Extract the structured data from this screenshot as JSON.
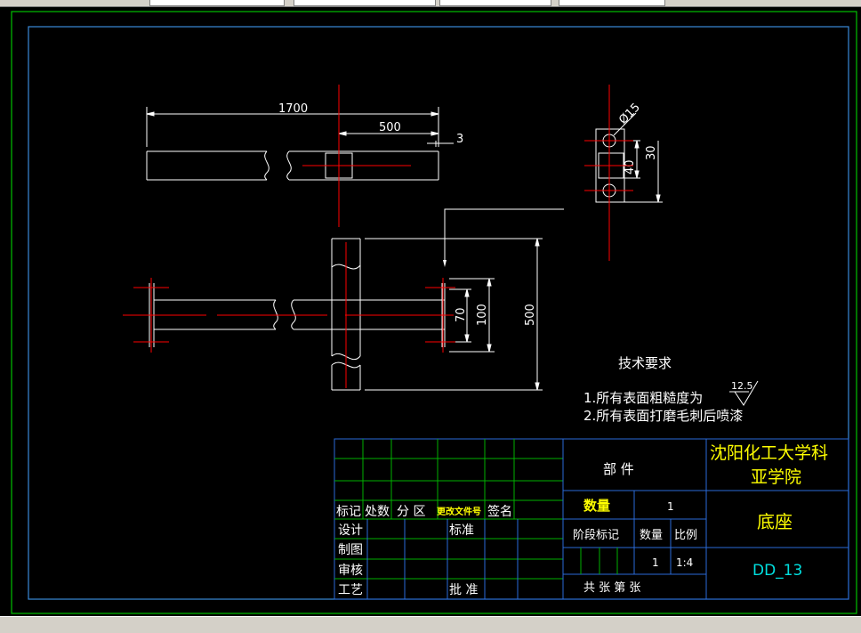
{
  "colors": {
    "background": "#000000",
    "outer_border": "#00c000",
    "inner_border": "#3a8ad8",
    "geometry": "#ffffff",
    "centerline": "#ff0000",
    "table_grid": "#00b000",
    "table_grid_blue": "#2a6ad8",
    "label_white": "#ffffff",
    "label_yellow": "#ffff00",
    "label_cyan": "#00e0e0"
  },
  "dimensions": {
    "total_length": "1700",
    "offset_length": "500",
    "gap": "3",
    "hole_diameter": "Ø15",
    "hole_spacing": "40",
    "edge_distance": "30",
    "inner_height": "70",
    "plate_height": "100",
    "overall_height": "500"
  },
  "notes": {
    "title": "技术要求",
    "roughness_value": "12.5",
    "line1": "1.所有表面粗糙度为",
    "line2": "2.所有表面打磨毛刺后喷漆"
  },
  "title_block": {
    "revision_labels": [
      "标记",
      "处数",
      "分 区",
      "更改文件号",
      "签名"
    ],
    "role_labels": [
      "设计",
      "制图",
      "审核",
      "工艺"
    ],
    "standard_label": "标准",
    "approve_label": "批 准",
    "part_label": "部  件",
    "quantity_label": "数量",
    "quantity_value": "1",
    "stage_label": "阶段标记",
    "qty_label2": "数量",
    "scale_label": "比例",
    "qty_value2": "1",
    "scale_value": "1:4",
    "sheets_label": "共  张   第  张",
    "school_line1": "沈阳化工大学科",
    "school_line2": "亚学院",
    "part_name": "底座",
    "drawing_number": "DD_13"
  }
}
